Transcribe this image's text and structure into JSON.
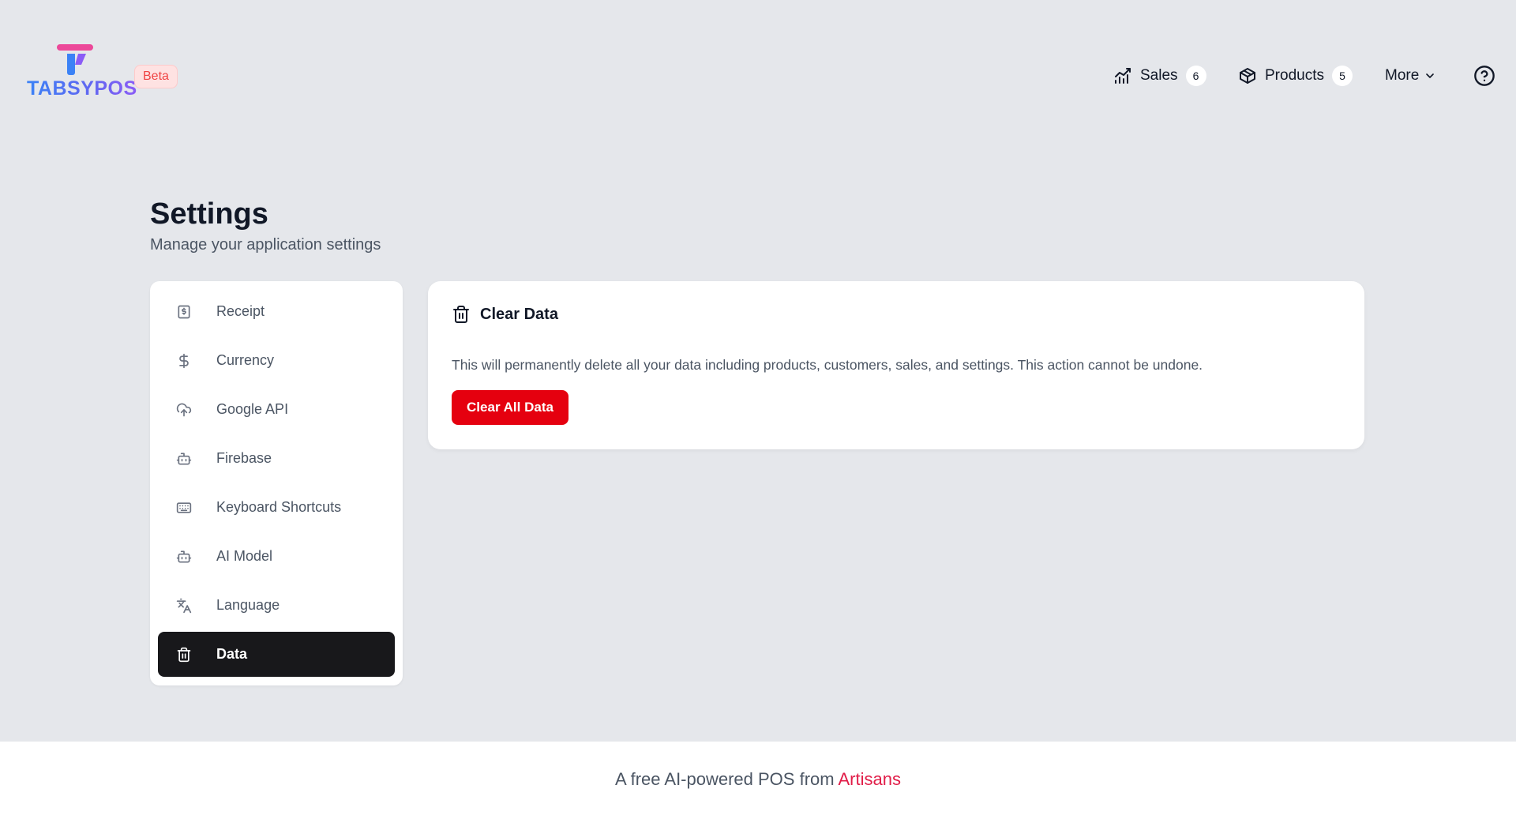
{
  "brand": {
    "name": "TABSYPOS",
    "badge": "Beta",
    "colors": {
      "pink": "#ec4899",
      "blue": "#3b82f6",
      "purple": "#8b5cf6"
    }
  },
  "nav": {
    "sales": {
      "label": "Sales",
      "count": "6",
      "icon": "sales-chart-icon"
    },
    "products": {
      "label": "Products",
      "count": "5",
      "icon": "box-icon"
    },
    "more": {
      "label": "More",
      "icon": "chevron-down-icon"
    },
    "help": {
      "icon": "help-circle-icon"
    }
  },
  "page": {
    "title": "Settings",
    "subtitle": "Manage your application settings"
  },
  "sidebar": {
    "items": [
      {
        "label": "Receipt",
        "icon": "receipt-icon",
        "active": false
      },
      {
        "label": "Currency",
        "icon": "dollar-icon",
        "active": false
      },
      {
        "label": "Google API",
        "icon": "cloud-upload-icon",
        "active": false
      },
      {
        "label": "Firebase",
        "icon": "bot-icon",
        "active": false
      },
      {
        "label": "Keyboard Shortcuts",
        "icon": "keyboard-icon",
        "active": false
      },
      {
        "label": "AI Model",
        "icon": "bot-icon",
        "active": false
      },
      {
        "label": "Language",
        "icon": "translate-icon",
        "active": false
      },
      {
        "label": "Data",
        "icon": "trash-icon",
        "active": true
      }
    ]
  },
  "panel": {
    "title": "Clear Data",
    "icon": "trash-icon",
    "description": "This will permanently delete all your data including products, customers, sales, and settings. This action cannot be undone.",
    "button_label": "Clear All Data",
    "button_color": "#e5000f"
  },
  "footer": {
    "prefix": "A free AI-powered POS from ",
    "link": "Artisans"
  }
}
